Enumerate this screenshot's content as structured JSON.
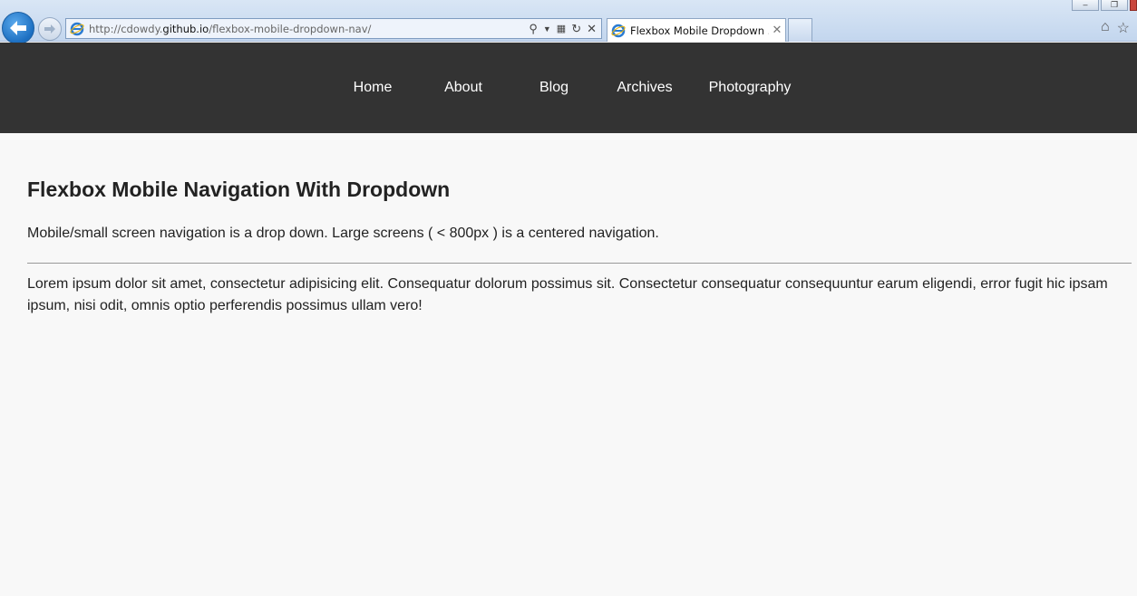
{
  "browser": {
    "url_prefix": "http://cdowdy.",
    "url_domain": "github.io",
    "url_path": "/flexbox-mobile-dropdown-nav/",
    "tab_title": "Flexbox Mobile Dropdown ...",
    "icons": {
      "back": "back-arrow-icon",
      "forward": "forward-arrow-icon",
      "search": "search-icon",
      "compat": "compat-view-icon",
      "refresh": "refresh-icon",
      "stop": "stop-icon",
      "home": "home-icon",
      "favorites": "star-icon"
    }
  },
  "nav": {
    "items": [
      {
        "label": "Home"
      },
      {
        "label": "About"
      },
      {
        "label": "Blog"
      },
      {
        "label": "Archives"
      },
      {
        "label": "Photography"
      }
    ]
  },
  "main": {
    "title": "Flexbox Mobile Navigation With Dropdown",
    "description": "Mobile/small screen navigation is a drop down. Large screens ( < 800px ) is a centered navigation.",
    "lorem": "Lorem ipsum dolor sit amet, consectetur adipisicing elit. Consequatur dolorum possimus sit. Consectetur consequatur consequuntur earum eligendi, error fugit hic ipsam ipsum, nisi odit, omnis optio perferendis possimus ullam vero!"
  },
  "colors": {
    "nav_bg": "#333333",
    "page_bg": "#f8f8f8",
    "text": "#222222"
  }
}
